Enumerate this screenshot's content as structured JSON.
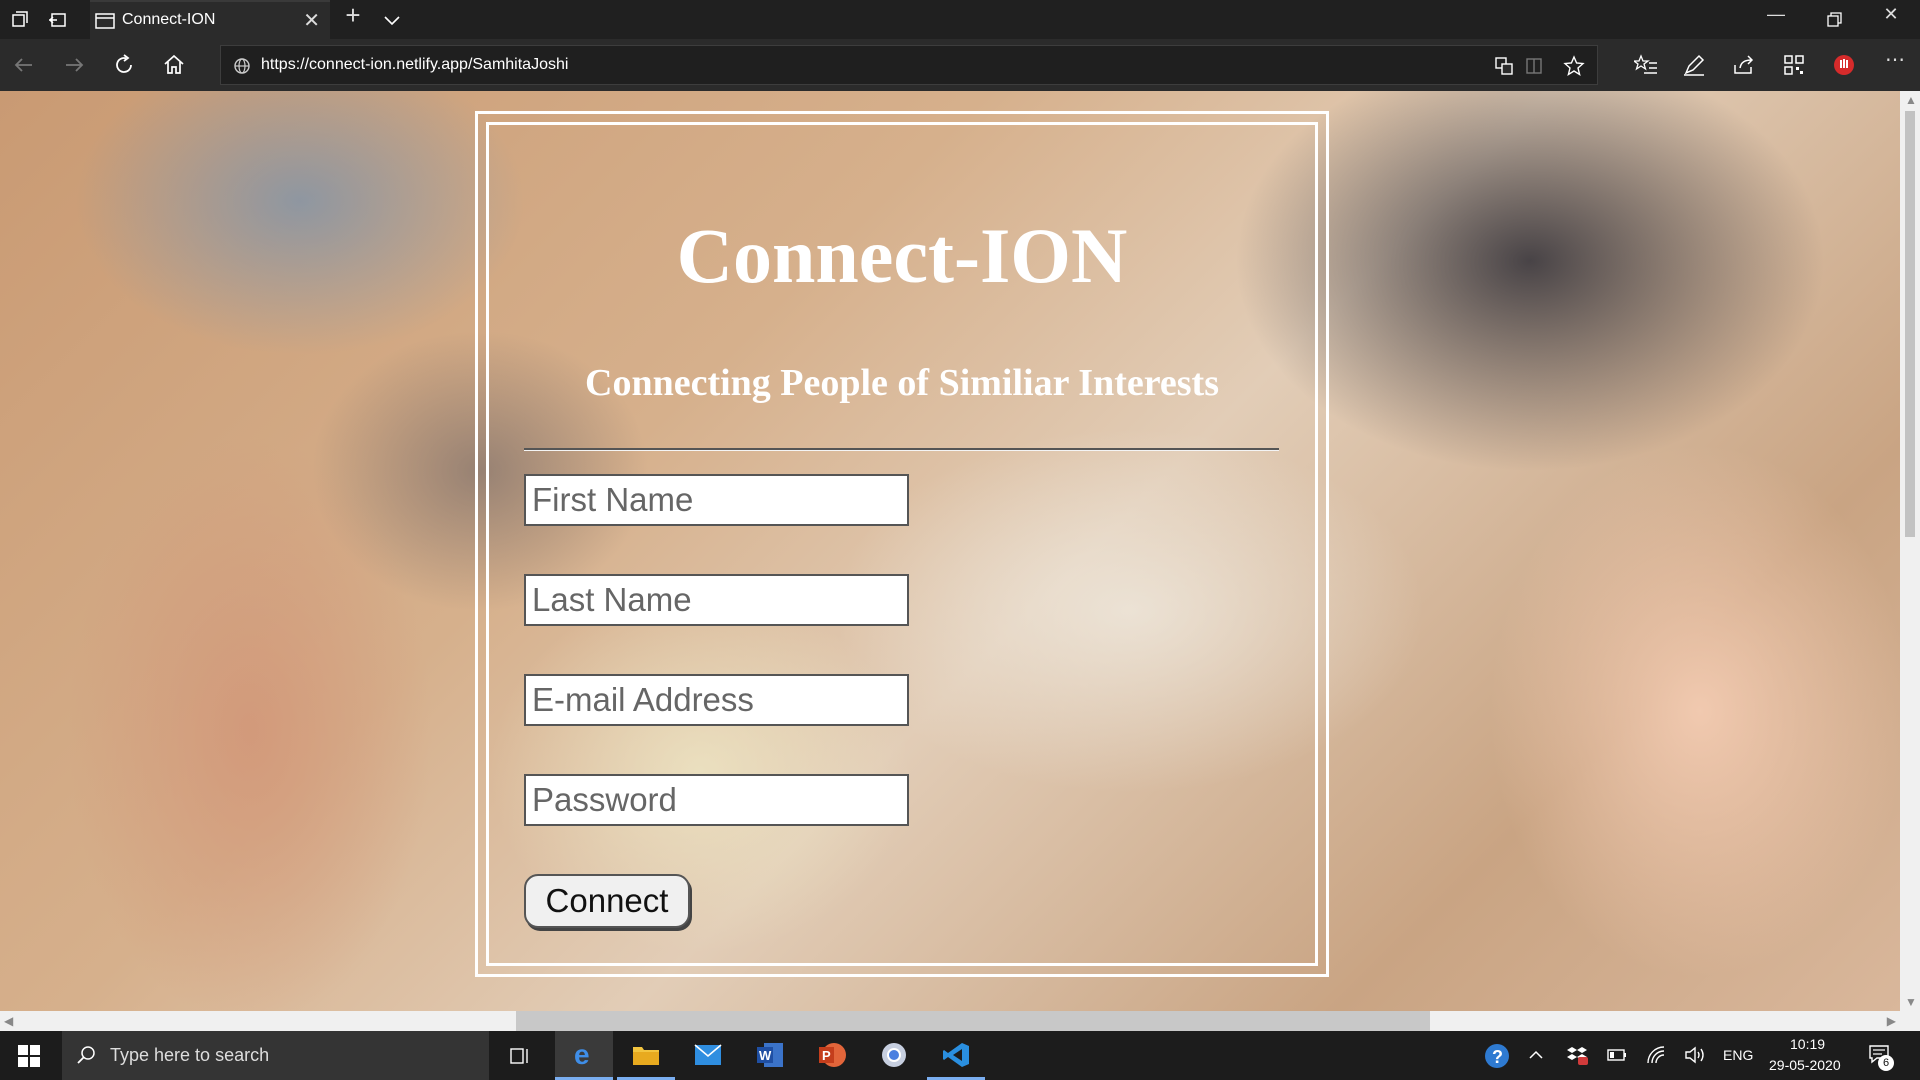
{
  "browser": {
    "tab_title": "Connect-ION",
    "url": "https://connect-ion.netlify.app/SamhitaJoshi"
  },
  "page": {
    "heading": "Connect-ION",
    "subheading": "Connecting People of Similiar Interests",
    "fields": {
      "first_name_placeholder": "First Name",
      "last_name_placeholder": "Last Name",
      "email_placeholder": "E-mail Address",
      "password_placeholder": "Password"
    },
    "connect_label": "Connect"
  },
  "taskbar": {
    "search_placeholder": "Type here to search",
    "language": "ENG",
    "time": "10:19",
    "date": "29-05-2020",
    "notification_count": "6",
    "apps": [
      "task-view",
      "edge",
      "file-explorer",
      "mail",
      "word",
      "powerpoint",
      "chrome",
      "vscode"
    ]
  }
}
